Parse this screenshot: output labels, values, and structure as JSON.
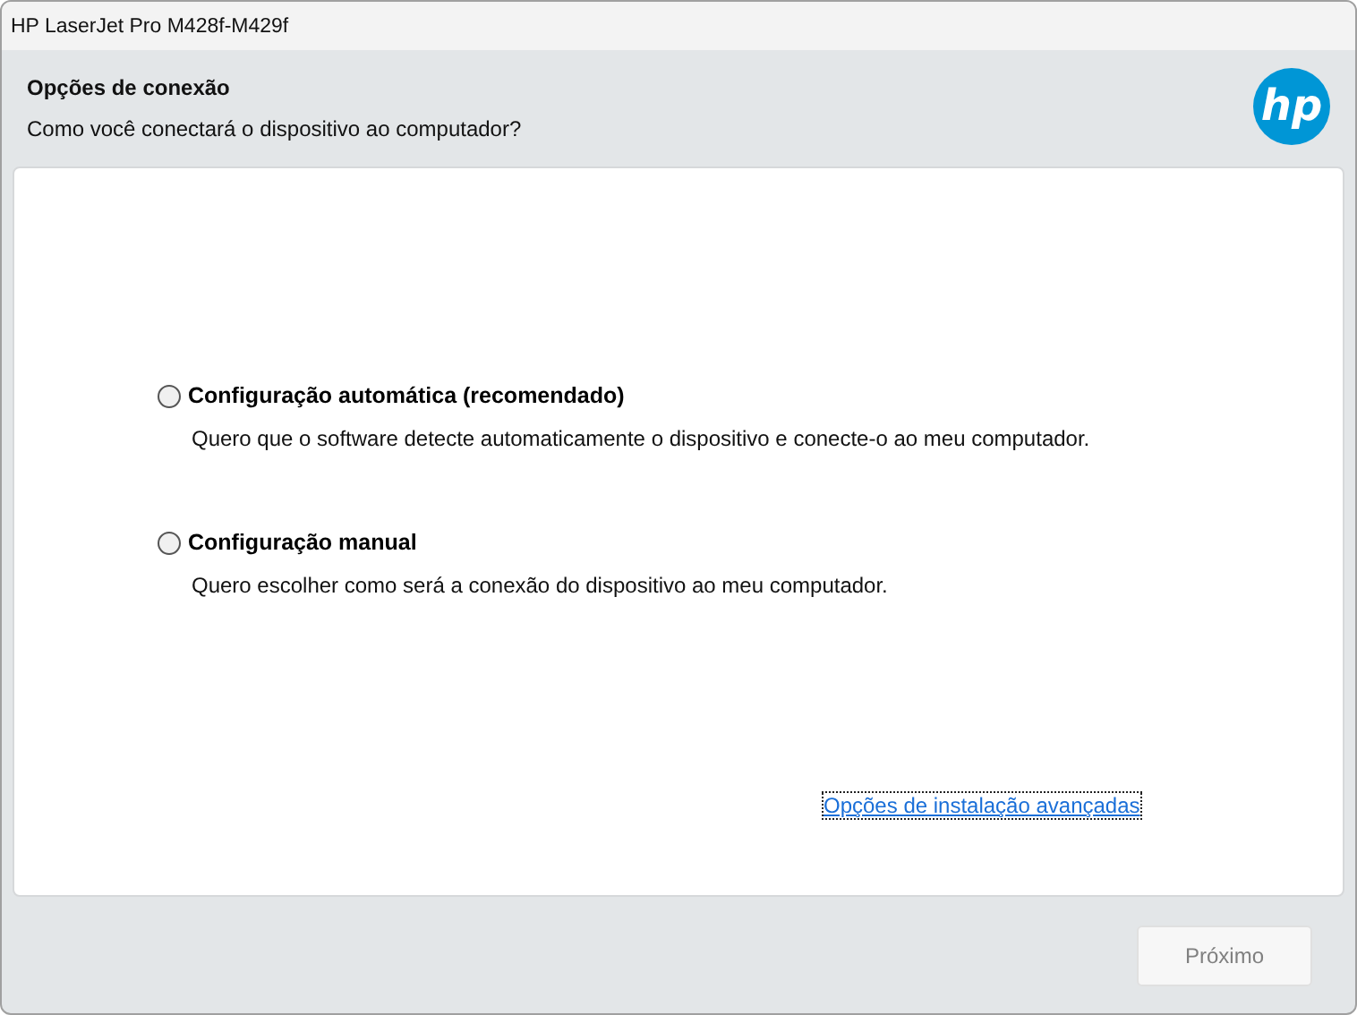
{
  "window": {
    "title": "HP LaserJet Pro M428f-M429f"
  },
  "header": {
    "title": "Opções de conexão",
    "subtitle": "Como você conectará o dispositivo ao computador?",
    "logo_text": "hp"
  },
  "options": [
    {
      "label": "Configuração automática (recomendado)",
      "description": "Quero que o software detecte automaticamente o dispositivo e conecte-o ao meu computador.",
      "selected": false
    },
    {
      "label": "Configuração manual",
      "description": "Quero escolher como será a conexão do dispositivo ao meu computador.",
      "selected": false
    }
  ],
  "advanced_link": "Opções de instalação avançadas",
  "next_button": {
    "label": "Próximo",
    "disabled": true
  }
}
